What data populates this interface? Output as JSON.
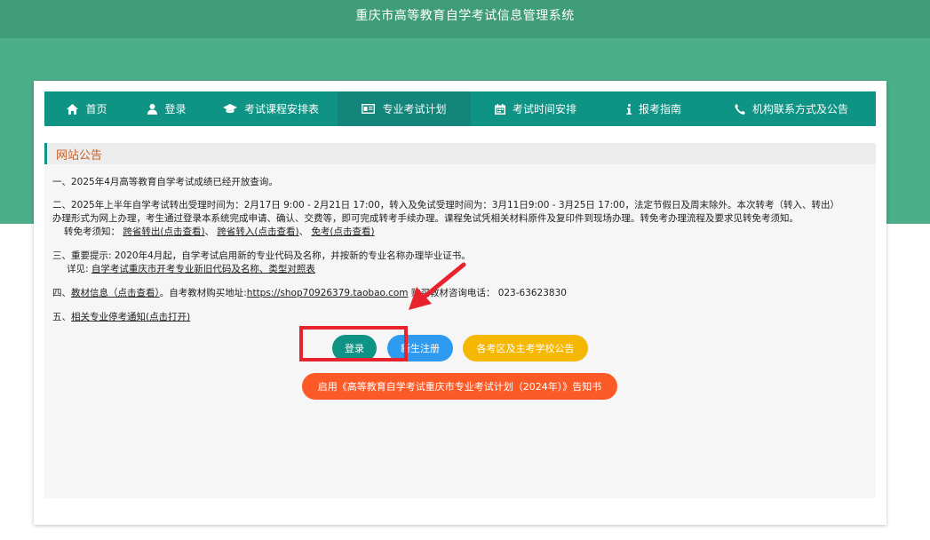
{
  "header": {
    "title": "重庆市高等教育自学考试信息管理系统"
  },
  "nav": [
    {
      "label": "首页",
      "icon": "home-icon"
    },
    {
      "label": "登录",
      "icon": "user-icon"
    },
    {
      "label": "考试课程安排表",
      "icon": "graduation-cap-icon"
    },
    {
      "label": "专业考试计划",
      "icon": "id-card-icon",
      "active": true
    },
    {
      "label": "考试时间安排",
      "icon": "calendar-icon"
    },
    {
      "label": "报考指南",
      "icon": "info-icon"
    },
    {
      "label": "机构联系方式及公告",
      "icon": "phone-icon"
    }
  ],
  "notice": {
    "title": "网站公告",
    "item1": "一、2025年4月高等教育自学考试成绩已经开放查询。",
    "item2_line1": "二、2025年上半年自学考试转出受理时间为：2月17日 9:00 - 2月21日 17:00，转入及免试受理时间为：3月11日9:00 - 3月25日 17:00，法定节假日及周末除外。本次转考（转入、转出）",
    "item2_line2": "办理形式为网上办理，考生通过登录本系统完成申请、确认、交费等，即可完成转考手续办理。课程免试凭相关材料原件及复印件到现场办理。转免考办理流程及要求见转免考须知。",
    "item2_prefix": "转免考须知：",
    "item2_link1": "跨省转出(点击查看)",
    "item2_sep1": "、",
    "item2_link2": "跨省转入(点击查看)",
    "item2_sep2": "、",
    "item2_link3": "免考(点击查看)",
    "item3_line1": "三、重要提示: 2020年4月起，自学考试启用新的专业代码及名称，并按新的专业名称办理毕业证书。",
    "item3_prefix": "详见: ",
    "item3_link": "自学考试重庆市开考专业新旧代码及名称、类型对照表",
    "item4_prefix": "四、",
    "item4_link": "教材信息（点击查看）",
    "item4_mid": "。自考教材购买地址:",
    "item4_url": "https://shop70926379.taobao.com",
    "item4_suffix": "  购买教材咨询电话： 023-63623830",
    "item5_prefix": "五、",
    "item5_link": "相关专业停考通知(点击打开)"
  },
  "buttons": {
    "login": "登录",
    "register": "新生注册",
    "announcements": "各考区及主考学校公告",
    "plan_notice": "启用《高等教育自学考试重庆市专业考试计划（2024年）》告知书"
  },
  "colors": {
    "header_green": "#4caf89",
    "nav_teal": "#0e9384",
    "login_button": "#0e9384",
    "register_button": "#2f9bf0",
    "announce_button": "#f5b700",
    "plan_button": "#fb5a27",
    "annotation_red": "#e8232e"
  }
}
